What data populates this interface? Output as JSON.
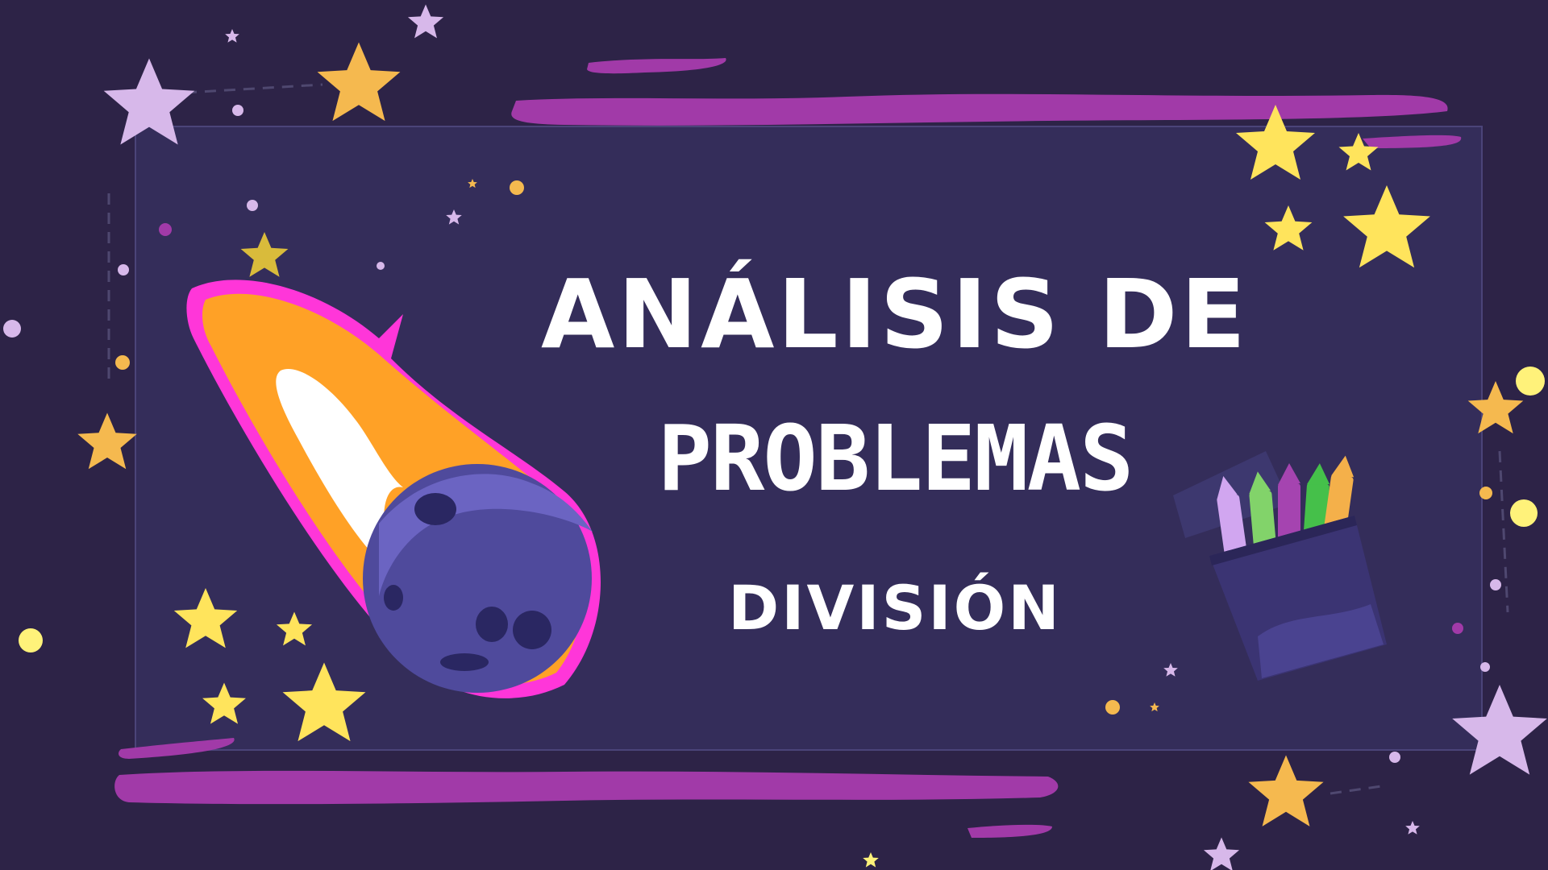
{
  "slide": {
    "title_line1": "ANÁLISIS DE",
    "title_line2": "PROBLEMAS",
    "subtitle": "DIVISIÓN"
  },
  "colors": {
    "background": "#2d2347",
    "panel": "#342d5a",
    "brush_stroke": "#a13aa8",
    "comet_outline": "#ff36d9",
    "comet_tail": "#ffa126",
    "meteor": "#4f4a9c",
    "star_yellow": "#ffe45c",
    "star_orange": "#f5b94f",
    "star_lilac": "#d7b8ea"
  },
  "icons": [
    "comet-meteor-icon",
    "crayon-box-icon",
    "star-icon"
  ]
}
